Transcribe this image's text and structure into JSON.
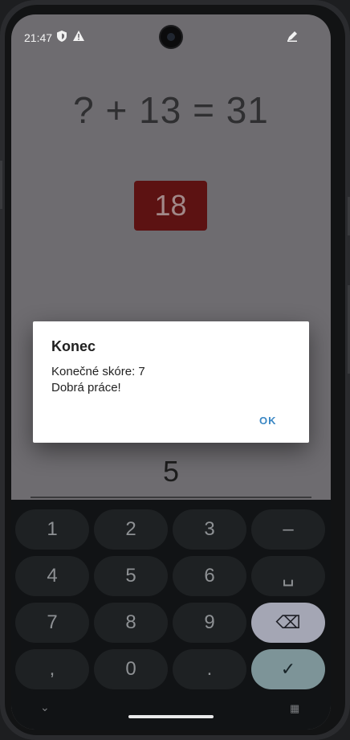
{
  "status_bar": {
    "time": "21:47",
    "left_icons": [
      "shield-icon",
      "warning-icon"
    ],
    "right_icons": [
      "edit-icon"
    ]
  },
  "game": {
    "equation": "? + 13 = 31",
    "answer": "18",
    "input_value": "5"
  },
  "dialog": {
    "title": "Konec",
    "message_line1": "Konečné skóre: 7",
    "message_line2": "Dobrá práce!",
    "ok_label": "OK"
  },
  "keyboard": {
    "rows": [
      [
        "1",
        "2",
        "3",
        "–"
      ],
      [
        "4",
        "5",
        "6",
        "␣"
      ],
      [
        "7",
        "8",
        "9",
        "⌫"
      ],
      [
        ",",
        "0",
        ".",
        "✓"
      ]
    ],
    "nav": {
      "collapse": "⌄",
      "switch": "▦"
    }
  },
  "colors": {
    "screen_dim": "#6e6c70",
    "answer_box": "#5c1212",
    "ok_button": "#3a87c4",
    "backspace_key": "#a4a6b4",
    "enter_key": "#7d9498"
  }
}
